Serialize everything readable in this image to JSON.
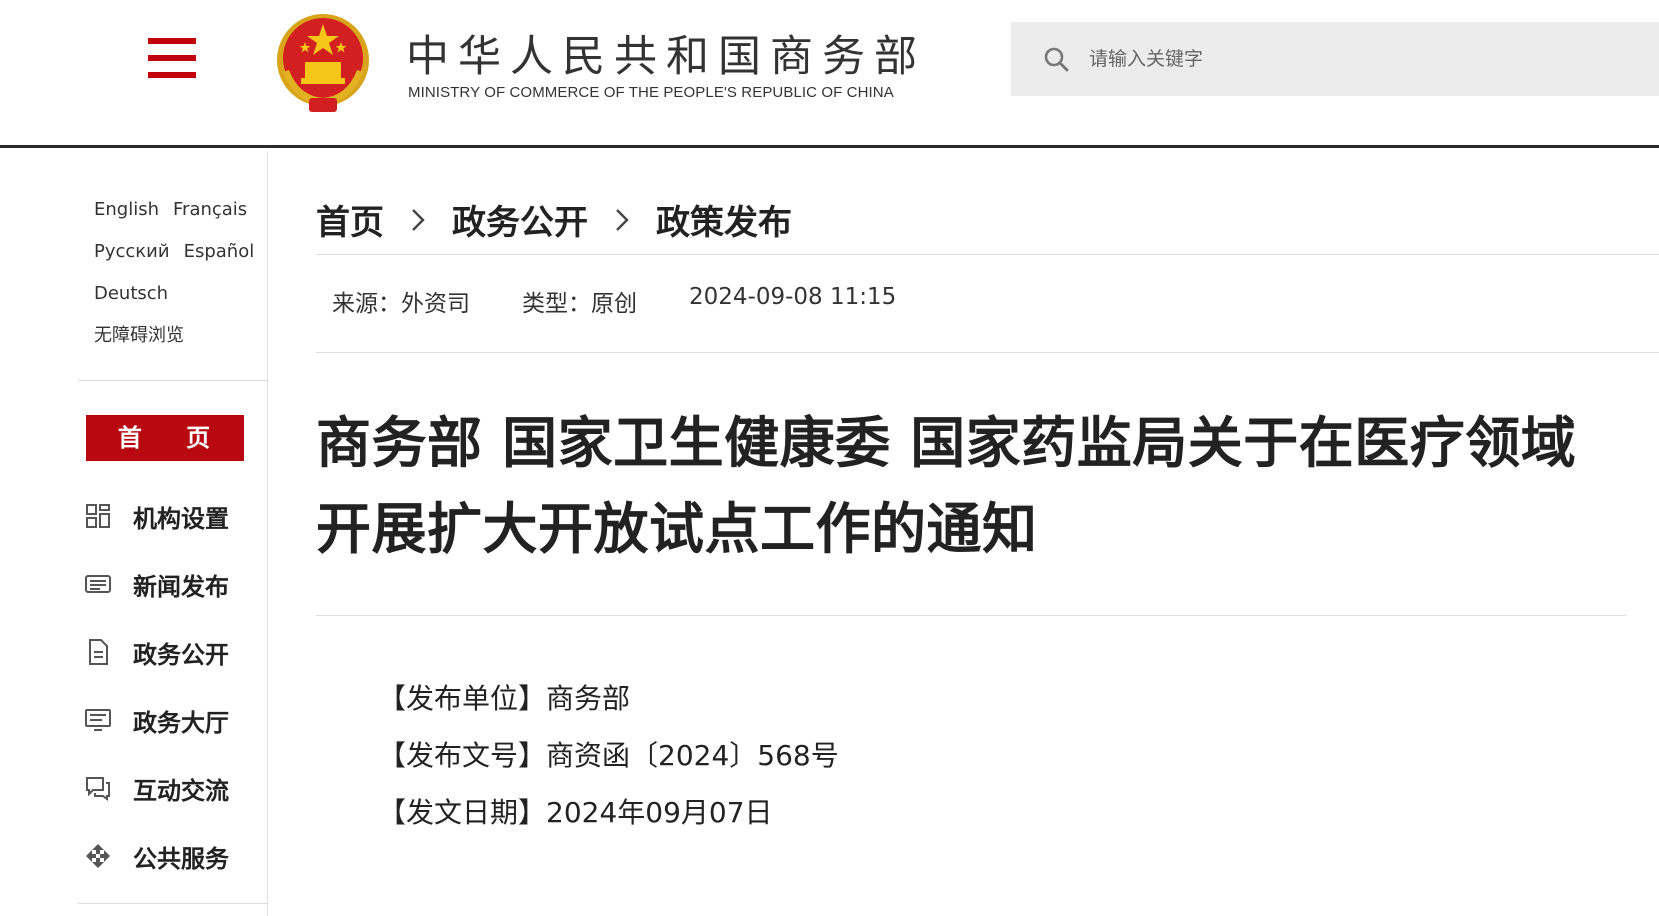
{
  "header": {
    "brand_cn": "中华人民共和国商务部",
    "brand_en": "MINISTRY OF COMMERCE OF THE PEOPLE'S REPUBLIC OF CHINA",
    "search_placeholder": "请输入关键字",
    "icons": [
      "menu-icon",
      "national-emblem",
      "search-icon"
    ],
    "accent_color": "#c0000b"
  },
  "sidebar": {
    "languages": [
      "English",
      "Français",
      "Русский",
      "Español",
      "Deutsch"
    ],
    "accessibility": "无障碍浏览",
    "home": "首 页",
    "items": [
      {
        "label": "机构设置",
        "icon": "grid-icon"
      },
      {
        "label": "新闻发布",
        "icon": "newspaper-icon"
      },
      {
        "label": "政务公开",
        "icon": "document-icon"
      },
      {
        "label": "政务大厅",
        "icon": "monitor-icon"
      },
      {
        "label": "互动交流",
        "icon": "chat-icon"
      },
      {
        "label": "公共服务",
        "icon": "service-icon"
      }
    ]
  },
  "breadcrumb": [
    "首页",
    "政务公开",
    "政策发布"
  ],
  "meta": {
    "source": "来源：外资司",
    "type": "类型：原创",
    "datetime": "2024-09-08 11:15"
  },
  "article": {
    "title": "商务部 国家卫生健康委 国家药监局关于在医疗领域开展扩大开放试点工作的通知",
    "issuer": "【发布单位】商务部",
    "doc_number": "【发布文号】商资函〔2024〕568号",
    "date": "【发文日期】2024年09月07日"
  }
}
